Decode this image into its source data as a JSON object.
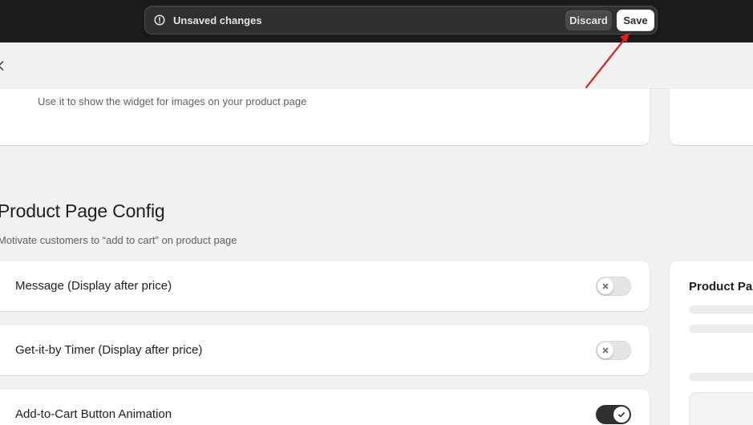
{
  "savebar": {
    "status_text": "Unsaved changes",
    "discard_label": "Discard",
    "save_label": "Save",
    "status_icon": "alert-circle-icon"
  },
  "subheader": {
    "back_icon": "chevron-left-icon"
  },
  "image_widget_card": {
    "description": "Use it to show the widget for images on your product page"
  },
  "product_page_config": {
    "title": "Product Page Config",
    "subtitle": "Motivate customers to “add to cart” on product page",
    "settings": [
      {
        "label": "Message (Display after price)",
        "enabled": false
      },
      {
        "label": "Get-it-by Timer (Display after price)",
        "enabled": false
      },
      {
        "label": "Add-to-Cart Button Animation",
        "enabled": true
      }
    ]
  },
  "preview": {
    "title": "Product Pa"
  },
  "annotation": {
    "color": "#e02020",
    "icon": "red-arrow-pointing-to-save"
  },
  "colors": {
    "topbar_bg": "#1a1a1a",
    "page_bg": "#f1f1f1",
    "toggle_on": "#303030"
  }
}
